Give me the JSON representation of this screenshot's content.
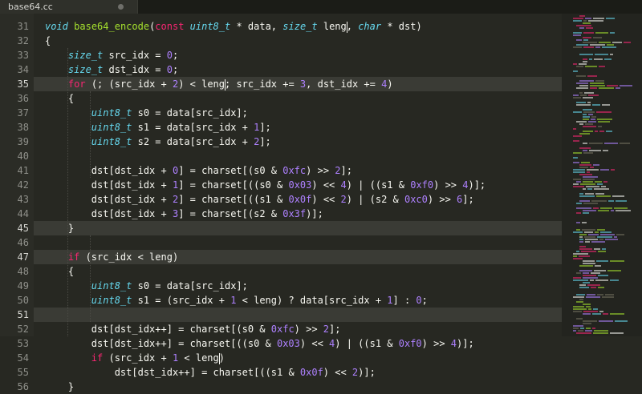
{
  "tab": {
    "title": "base64.cc",
    "modified_indicator": "unsaved-dot-icon"
  },
  "colors": {
    "background": "#272822",
    "gutter": "#2b2c26",
    "line_highlight": "#3a3b35",
    "keyword": "#f92672",
    "type": "#66d9ef",
    "number": "#ae81ff",
    "function": "#a6e22e",
    "text": "#f8f8f2",
    "line_number": "#8f908a"
  },
  "line_numbers": [
    "31",
    "32",
    "33",
    "34",
    "35",
    "36",
    "37",
    "38",
    "39",
    "40",
    "41",
    "42",
    "43",
    "44",
    "45",
    "46",
    "47",
    "48",
    "49",
    "50",
    "51",
    "52",
    "53",
    "54",
    "55",
    "56"
  ],
  "code": {
    "l31": {
      "t1": "void",
      "fn": "base64_encode",
      "p1": "(",
      "kw": "const",
      "sp": " ",
      "t2": "uint8_t",
      "p2": " * data, ",
      "t3": "size_t",
      "p3": " leng",
      "p3b": ", ",
      "t4": "char",
      "p4": " * dst)"
    },
    "l32": {
      "text": "{"
    },
    "l33": {
      "t": "size_t",
      "p1": " src_idx = ",
      "n": "0",
      "p2": ";"
    },
    "l34": {
      "t": "size_t",
      "p1": " dst_idx = ",
      "n": "0",
      "p2": ";"
    },
    "l35": {
      "k": "for",
      "p1": " (; (src_idx + ",
      "n1": "2",
      "p2": ") < leng",
      "p3": "; src_idx += ",
      "n2": "3",
      "p4": ", dst_idx += ",
      "n3": "4",
      "p5": ")"
    },
    "l36": {
      "text": "{"
    },
    "l37": {
      "t": "uint8_t",
      "p1": " s0 = data[src_idx];"
    },
    "l38": {
      "t": "uint8_t",
      "p1": " s1 = data[src_idx + ",
      "n": "1",
      "p2": "];"
    },
    "l39": {
      "t": "uint8_t",
      "p1": " s2 = data[src_idx + ",
      "n": "2",
      "p2": "];"
    },
    "l41": {
      "p1": "dst[dst_idx + ",
      "n1": "0",
      "p2": "] = charset[(s0 & ",
      "n2": "0xfc",
      "p3": ") >> ",
      "n3": "2",
      "p4": "];"
    },
    "l42": {
      "p1": "dst[dst_idx + ",
      "n1": "1",
      "p2": "] = charset[((s0 & ",
      "n2": "0x03",
      "p3": ") << ",
      "n3": "4",
      "p4": ") | ((s1 & ",
      "n4": "0xf0",
      "p5": ") >> ",
      "n5": "4",
      "p6": ")];"
    },
    "l43": {
      "p1": "dst[dst_idx + ",
      "n1": "2",
      "p2": "] = charset[((s1 & ",
      "n2": "0x0f",
      "p3": ") << ",
      "n3": "2",
      "p4": ") | (s2 & ",
      "n4": "0xc0",
      "p5": ") >> ",
      "n5": "6",
      "p6": "];"
    },
    "l44": {
      "p1": "dst[dst_idx + ",
      "n1": "3",
      "p2": "] = charset[(s2 & ",
      "n2": "0x3f",
      "p3": ")];"
    },
    "l45": {
      "text": "}"
    },
    "l47": {
      "k": "if",
      "p1": " (src_idx < leng)"
    },
    "l48": {
      "text": "{"
    },
    "l49": {
      "t": "uint8_t",
      "p1": " s0 = data[src_idx];"
    },
    "l50": {
      "t": "uint8_t",
      "p1": " s1 = (src_idx + ",
      "n1": "1",
      "p2": " < leng) ? data[src_idx + ",
      "n2": "1",
      "p3": "] : ",
      "n3": "0",
      "p4": ";"
    },
    "l52": {
      "p1": "dst[dst_idx++] = charset[(s0 & ",
      "n1": "0xfc",
      "p2": ") >> ",
      "n2": "2",
      "p3": "];"
    },
    "l53": {
      "p1": "dst[dst_idx++] = charset[((s0 & ",
      "n1": "0x03",
      "p2": ") << ",
      "n2": "4",
      "p3": ") | ((s1 & ",
      "n3": "0xf0",
      "p4": ") >> ",
      "n4": "4",
      "p5": ")];"
    },
    "l54": {
      "k": "if",
      "p1": " (src_idx + ",
      "n": "1",
      "p2": " < leng",
      "p3": ")"
    },
    "l55": {
      "p1": "dst[dst_idx++] = charset[((s1 & ",
      "n1": "0x0f",
      "p2": ") << ",
      "n2": "2",
      "p3": ")];"
    },
    "l56": {
      "text": "}"
    }
  }
}
